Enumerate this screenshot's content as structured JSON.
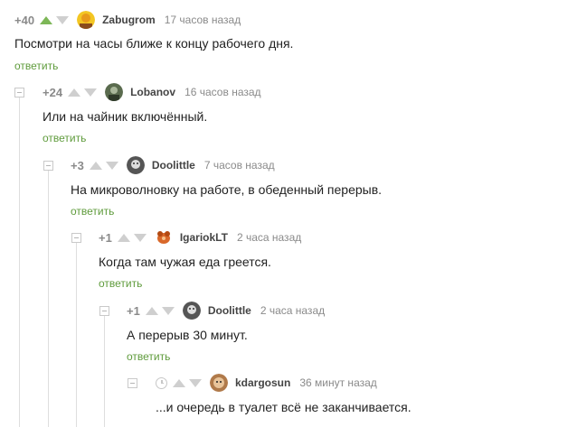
{
  "comments": [
    {
      "rating": "+40",
      "user": "Zabugrom",
      "time": "17 часов назад",
      "text": "Посмотри на часы ближе к концу рабочего дня.",
      "reply": "ответить",
      "avatar_color": "#f3c623"
    },
    {
      "rating": "+24",
      "user": "Lobanov",
      "time": "16 часов назад",
      "text": "Или на чайник включённый.",
      "reply": "ответить",
      "avatar_color": "#5a6b4e"
    },
    {
      "rating": "+3",
      "user": "Doolittle",
      "time": "7 часов назад",
      "text": "На микроволновку на работе, в обеденный перерыв.",
      "reply": "ответить",
      "avatar_color": "#555555"
    },
    {
      "rating": "+1",
      "user": "IgariokLT",
      "time": "2 часа назад",
      "text": "Когда там чужая еда греется.",
      "reply": "ответить",
      "avatar_color": "#d9682a"
    },
    {
      "rating": "+1",
      "user": "Doolittle",
      "time": "2 часа назад",
      "text": "А перерыв 30 минут.",
      "reply": "ответить",
      "avatar_color": "#555555"
    },
    {
      "rating": "",
      "user": "kdargosun",
      "time": "36 минут назад",
      "text": "...и очередь в туалет всё не заканчивается.",
      "reply": "",
      "avatar_color": "#b07a4a"
    }
  ],
  "colors": {
    "accent": "#5f9b3c",
    "upvote_active": "#7db757",
    "muted": "#8a8a8a"
  }
}
